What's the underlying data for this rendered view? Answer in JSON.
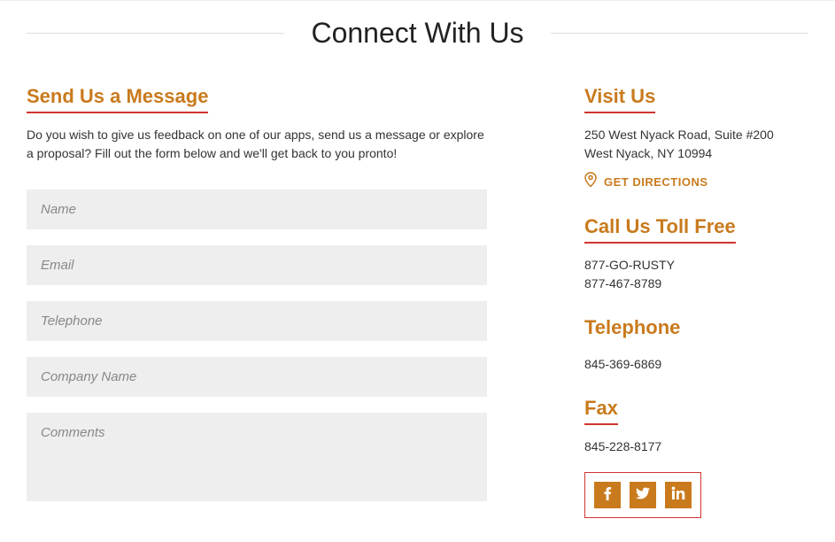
{
  "page_title": "Connect With Us",
  "message": {
    "heading": "Send Us a Message",
    "intro": "Do you wish to give us feedback on one of our apps, send us a message or explore a proposal? Fill out the form below and we'll get back to you pronto!",
    "fields": {
      "name": "Name",
      "email": "Email",
      "telephone": "Telephone",
      "company": "Company Name",
      "comments": "Comments"
    }
  },
  "visit": {
    "heading": "Visit Us",
    "addr1": "250 West Nyack Road, Suite #200",
    "addr2": "West Nyack, NY 10994",
    "directions": "GET DIRECTIONS"
  },
  "tollfree": {
    "heading": "Call Us Toll Free",
    "line1": "877-GO-RUSTY",
    "line2": "877-467-8789"
  },
  "telephone": {
    "heading": "Telephone",
    "number": "845-369-6869"
  },
  "fax": {
    "heading": "Fax",
    "number": "845-228-8177"
  }
}
